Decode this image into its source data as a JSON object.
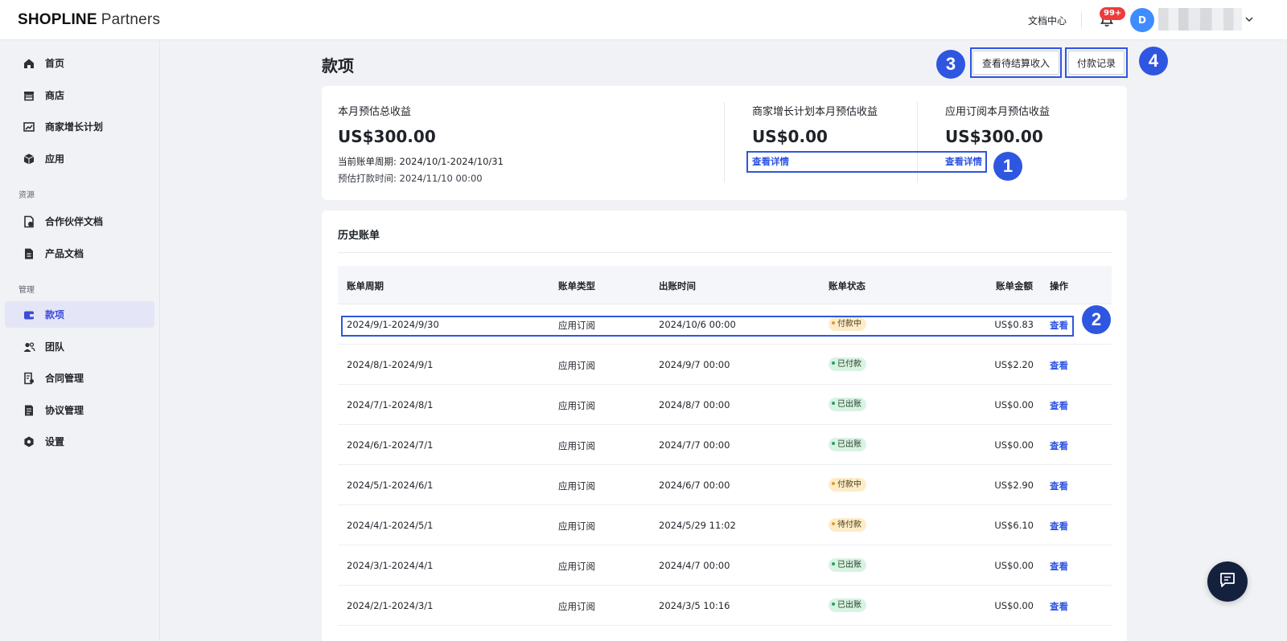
{
  "header": {
    "brand": "SHOPLINE",
    "product": "Partners",
    "docs_link": "文档中心",
    "notif_count": "99+",
    "avatar_initial": "D",
    "bell_icon": "bell-icon",
    "chevron_icon": "chevron-down-icon"
  },
  "sidebar": {
    "items": [
      {
        "label": "首页",
        "icon": "home-icon"
      },
      {
        "label": "商店",
        "icon": "store-icon"
      },
      {
        "label": "商家增长计划",
        "icon": "growth-chart-icon"
      },
      {
        "label": "应用",
        "icon": "cube-icon"
      }
    ],
    "section_resources": "资源",
    "resource_items": [
      {
        "label": "合作伙伴文档",
        "icon": "partner-doc-icon"
      },
      {
        "label": "产品文档",
        "icon": "document-icon"
      }
    ],
    "section_manage": "管理",
    "manage_items": [
      {
        "label": "款项",
        "icon": "wallet-icon",
        "active": true
      },
      {
        "label": "团队",
        "icon": "team-icon"
      },
      {
        "label": "合同管理",
        "icon": "contract-icon"
      },
      {
        "label": "协议管理",
        "icon": "agreement-icon"
      },
      {
        "label": "设置",
        "icon": "settings-icon"
      }
    ]
  },
  "page": {
    "title": "款项",
    "btn_pending_income": "查看待结算收入",
    "btn_payment_records": "付款记录"
  },
  "summary": {
    "total_label": "本月预估总收益",
    "total_amount": "US$300.00",
    "billing_period": "当前账单周期: 2024/10/1-2024/10/31",
    "payout_time": "预估打款时间: 2024/11/10 00:00",
    "growth_label": "商家增长计划本月预估收益",
    "growth_amount": "US$0.00",
    "growth_link": "查看详情",
    "sub_label": "应用订阅本月预估收益",
    "sub_amount": "US$300.00",
    "sub_link": "查看详情"
  },
  "markers": {
    "m1": "1",
    "m2": "2",
    "m3": "3",
    "m4": "4"
  },
  "history": {
    "title": "历史账单",
    "columns": [
      "账单周期",
      "账单类型",
      "出账时间",
      "账单状态",
      "账单金额",
      "操作"
    ],
    "rows": [
      {
        "period": "2024/9/1-2024/9/30",
        "type": "应用订阅",
        "time": "2024/10/6 00:00",
        "status": "付款中",
        "amount": "US$0.83",
        "op": "查看"
      },
      {
        "period": "2024/8/1-2024/9/1",
        "type": "应用订阅",
        "time": "2024/9/7 00:00",
        "status": "已付款",
        "amount": "US$2.20",
        "op": "查看"
      },
      {
        "period": "2024/7/1-2024/8/1",
        "type": "应用订阅",
        "time": "2024/8/7 00:00",
        "status": "已出账",
        "amount": "US$0.00",
        "op": "查看"
      },
      {
        "period": "2024/6/1-2024/7/1",
        "type": "应用订阅",
        "time": "2024/7/7 00:00",
        "status": "已出账",
        "amount": "US$0.00",
        "op": "查看"
      },
      {
        "period": "2024/5/1-2024/6/1",
        "type": "应用订阅",
        "time": "2024/6/7 00:00",
        "status": "付款中",
        "amount": "US$2.90",
        "op": "查看"
      },
      {
        "period": "2024/4/1-2024/5/1",
        "type": "应用订阅",
        "time": "2024/5/29 11:02",
        "status": "待付款",
        "amount": "US$6.10",
        "op": "查看"
      },
      {
        "period": "2024/3/1-2024/4/1",
        "type": "应用订阅",
        "time": "2024/4/7 00:00",
        "status": "已出账",
        "amount": "US$0.00",
        "op": "查看"
      },
      {
        "period": "2024/2/1-2024/3/1",
        "type": "应用订阅",
        "time": "2024/3/5 10:16",
        "status": "已出账",
        "amount": "US$0.00",
        "op": "查看"
      }
    ]
  },
  "chat": {
    "icon": "chat-icon"
  },
  "colors": {
    "accent": "#2f56e0",
    "active_nav_bg": "#e4e6f7",
    "paying": "#e2992f",
    "paid": "#22a45b"
  }
}
